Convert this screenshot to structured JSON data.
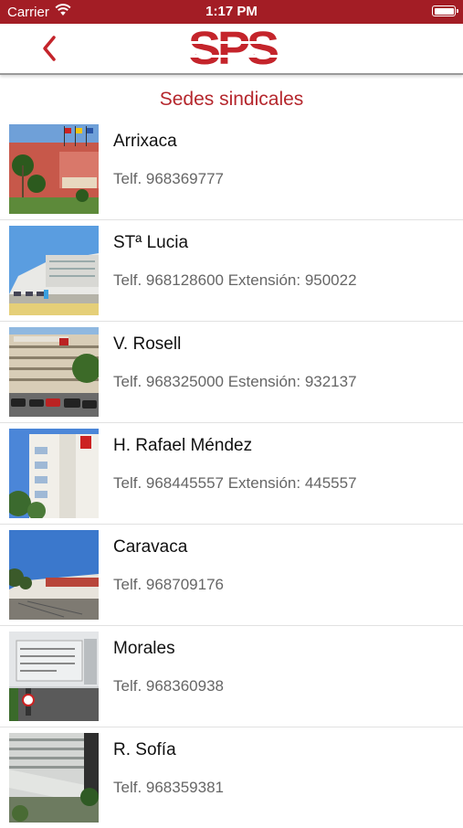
{
  "status": {
    "carrier": "Carrier",
    "time": "1:17 PM"
  },
  "nav": {
    "logo": "SPS"
  },
  "section_title": "Sedes sindicales",
  "items": [
    {
      "name": "Arrixaca",
      "phone": "Telf. 968369777"
    },
    {
      "name": "STª Lucia",
      "phone": "Telf. 968128600 Extensión: 950022"
    },
    {
      "name": "V. Rosell",
      "phone": "Telf. 968325000 Estensión: 932137"
    },
    {
      "name": "H. Rafael Méndez",
      "phone": "Telf. 968445557 Extensión: 445557"
    },
    {
      "name": "Caravaca",
      "phone": "Telf. 968709176"
    },
    {
      "name": "Morales",
      "phone": "Telf. 968360938"
    },
    {
      "name": "R. Sofía",
      "phone": "Telf. 968359381"
    }
  ],
  "colors": {
    "brand": "#c4242b",
    "status_bar": "#a31d25"
  }
}
